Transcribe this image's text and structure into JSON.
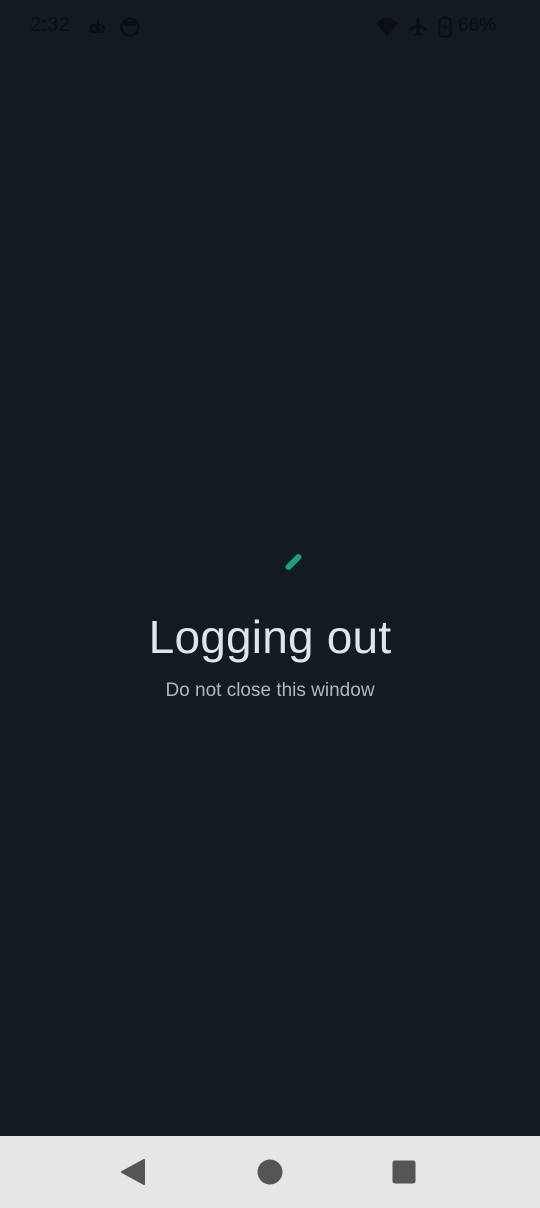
{
  "status_bar": {
    "time": "2:32",
    "battery_percent": "66%",
    "icons": [
      "game-controller-icon",
      "face-icon",
      "wifi-icon",
      "airplane-icon",
      "battery-charging-icon"
    ]
  },
  "content": {
    "title": "Logging out",
    "subtitle": "Do not close this window",
    "spinner_color": "#16a37f"
  },
  "nav_bar": {
    "buttons": [
      "back-icon",
      "home-icon",
      "recents-icon"
    ],
    "background": "#e6e6e6"
  },
  "colors": {
    "background": "#131a21",
    "title": "#dfe5ec",
    "subtitle": "#aeb7c2"
  }
}
